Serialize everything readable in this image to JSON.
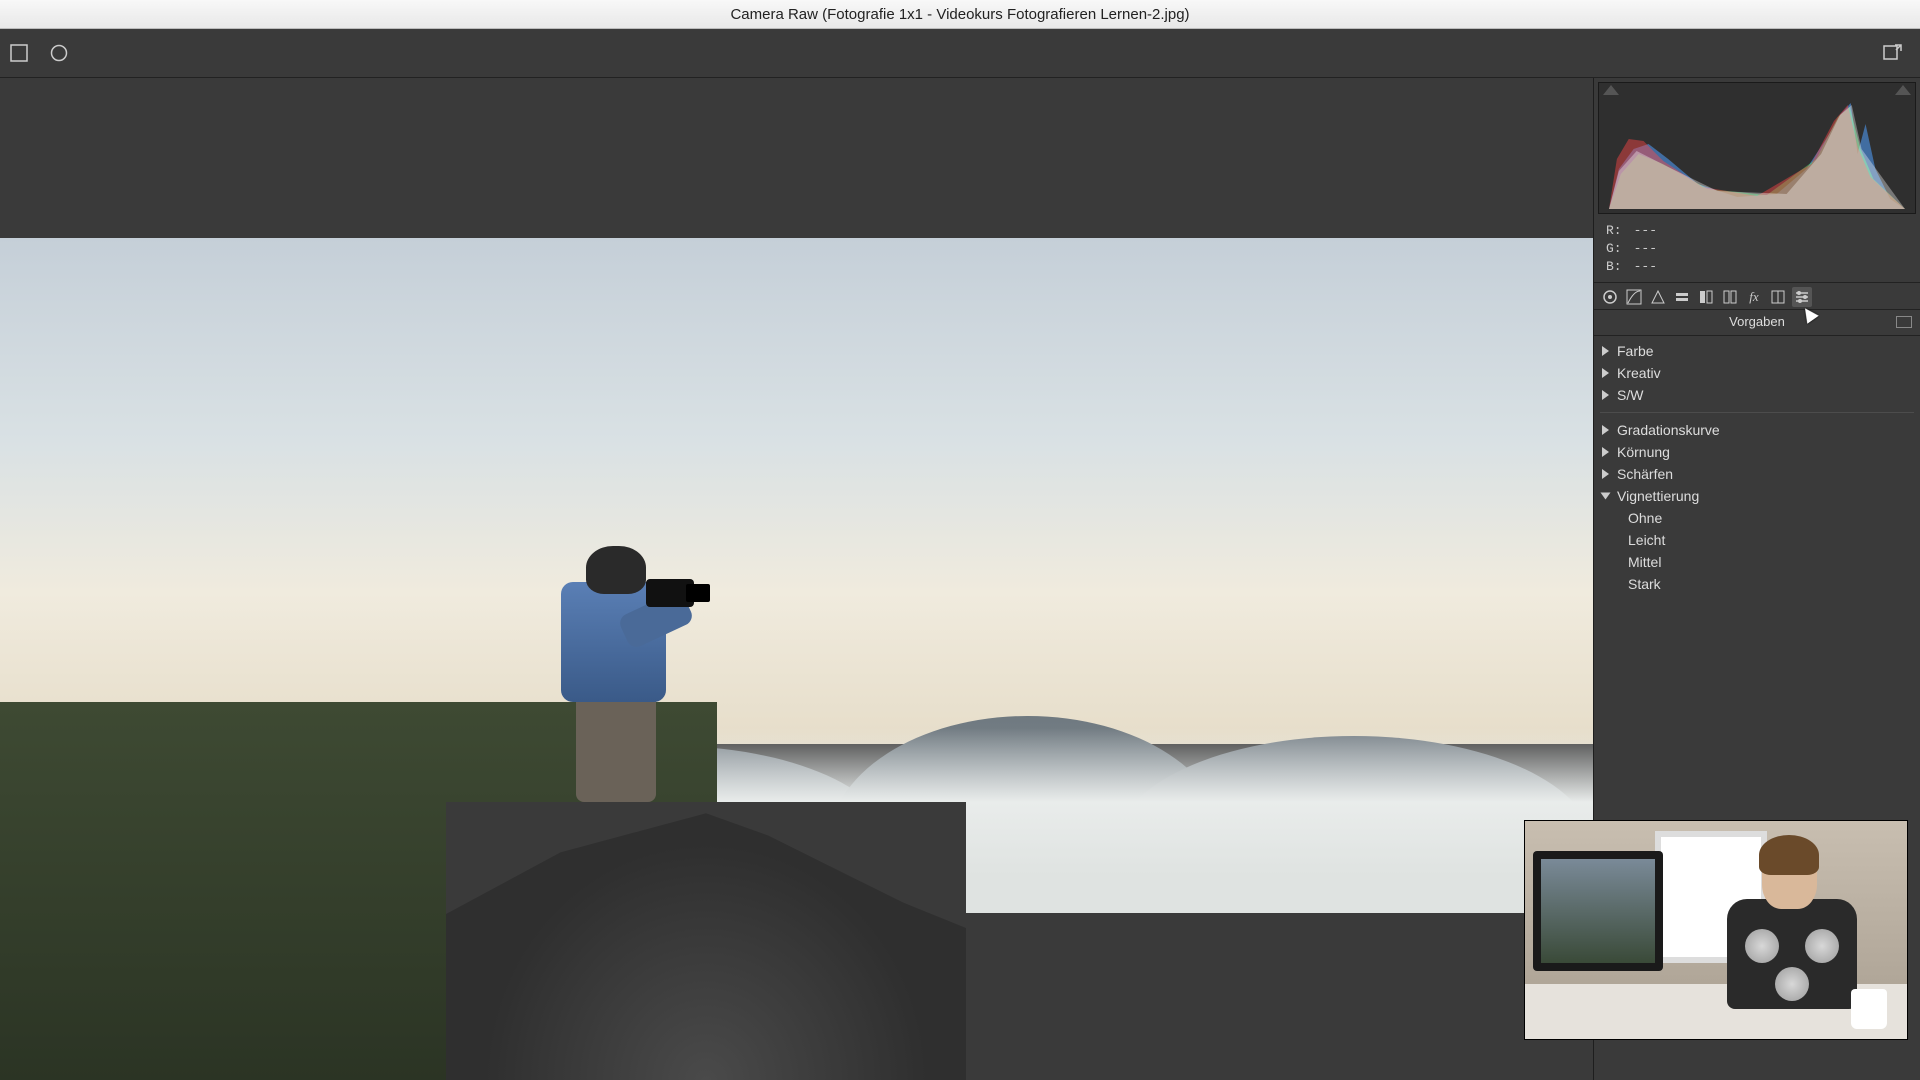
{
  "window_title": "Camera Raw (Fotografie 1x1 - Videokurs Fotografieren Lernen-2.jpg)",
  "rgb": {
    "r_label": "R:",
    "g_label": "G:",
    "b_label": "B:",
    "r_val": "---",
    "g_val": "---",
    "b_val": "---"
  },
  "tabs": [
    {
      "name": "basic-tab-icon"
    },
    {
      "name": "tone-curve-tab-icon"
    },
    {
      "name": "detail-tab-icon"
    },
    {
      "name": "hsl-tab-icon"
    },
    {
      "name": "split-toning-tab-icon"
    },
    {
      "name": "lens-corrections-tab-icon"
    },
    {
      "name": "effects-tab-icon"
    },
    {
      "name": "calibration-tab-icon"
    },
    {
      "name": "presets-tab-icon"
    }
  ],
  "active_tab_index": 8,
  "panel_title": "Vorgaben",
  "preset_groups": [
    {
      "label": "Farbe",
      "open": false
    },
    {
      "label": "Kreativ",
      "open": false
    },
    {
      "label": "S/W",
      "open": false
    }
  ],
  "preset_groups2": [
    {
      "label": "Gradationskurve",
      "open": false
    },
    {
      "label": "Körnung",
      "open": false
    },
    {
      "label": "Schärfen",
      "open": false
    },
    {
      "label": "Vignettierung",
      "open": true,
      "items": [
        "Ohne",
        "Leicht",
        "Mittel",
        "Stark"
      ]
    }
  ]
}
